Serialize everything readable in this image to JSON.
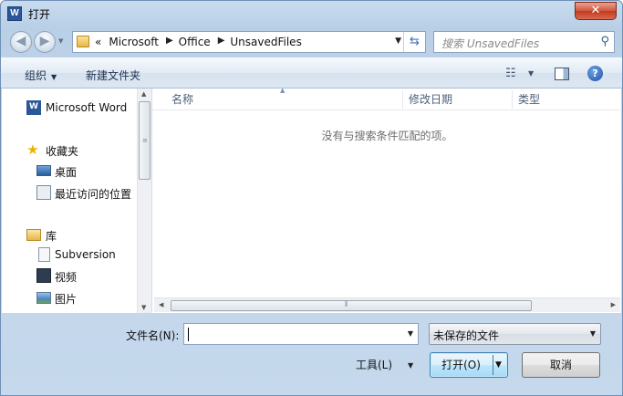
{
  "window": {
    "title": "打开",
    "close_icon": "✕"
  },
  "nav": {
    "breadcrumbs": [
      {
        "label": "«"
      },
      {
        "label": "Microsoft"
      },
      {
        "label": "Office"
      },
      {
        "label": "UnsavedFiles"
      }
    ],
    "search_placeholder": "搜索 UnsavedFiles"
  },
  "toolbar": {
    "organize_label": "组织",
    "new_folder_label": "新建文件夹"
  },
  "sidebar": {
    "app_item": {
      "label": "Microsoft Word",
      "icon": "word-icon"
    },
    "favorites": {
      "label": "收藏夹",
      "items": [
        {
          "label": "桌面",
          "icon": "desktop-icon"
        },
        {
          "label": "最近访问的位置",
          "icon": "recent-places-icon"
        }
      ]
    },
    "libraries": {
      "label": "库",
      "items": [
        {
          "label": "Subversion",
          "icon": "document-icon"
        },
        {
          "label": "视频",
          "icon": "video-icon"
        },
        {
          "label": "图片",
          "icon": "picture-icon"
        }
      ]
    }
  },
  "file_list": {
    "columns": [
      {
        "label": "名称"
      },
      {
        "label": "修改日期"
      },
      {
        "label": "类型"
      }
    ],
    "empty_message": "没有与搜索条件匹配的项。"
  },
  "footer": {
    "filename_label": "文件名(N):",
    "filename_value": "",
    "filetype_value": "未保存的文件",
    "tools_label": "工具(L)",
    "open_label": "打开(O)",
    "cancel_label": "取消"
  }
}
